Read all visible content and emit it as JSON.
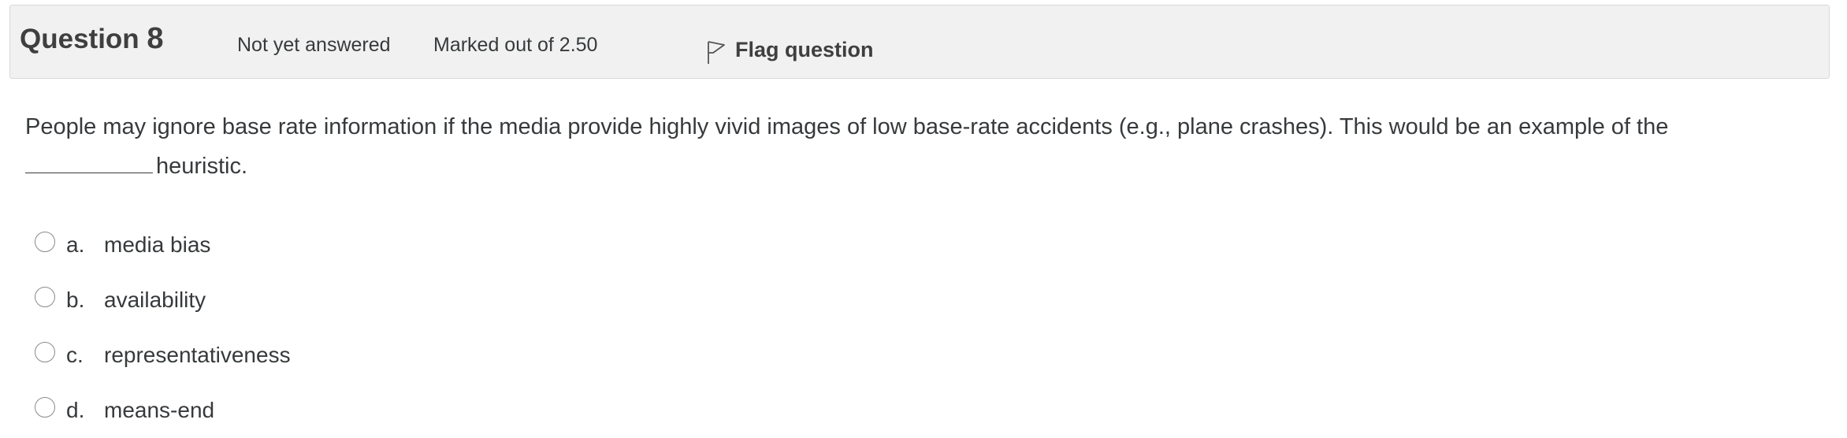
{
  "info": {
    "question_word": "Question",
    "question_number": "8",
    "state": "Not yet answered",
    "grade": "Marked out of 2.50",
    "flag_label": "Flag question"
  },
  "question": {
    "text_before_blank": "People may ignore base rate information if the media provide highly vivid images of low base-rate accidents (e.g., plane crashes). This would be an example of the",
    "text_after_blank": "heuristic."
  },
  "answers": [
    {
      "letter": "a.",
      "text": "media bias"
    },
    {
      "letter": "b.",
      "text": "availability"
    },
    {
      "letter": "c.",
      "text": "representativeness"
    },
    {
      "letter": "d.",
      "text": "means-end"
    }
  ],
  "icons": {
    "flag": "flag-outline-icon",
    "radio": "radio-unselected"
  },
  "colors": {
    "info_bg": "#f1f1f1",
    "info_border": "#d9d9d9",
    "text": "#373a3c"
  }
}
